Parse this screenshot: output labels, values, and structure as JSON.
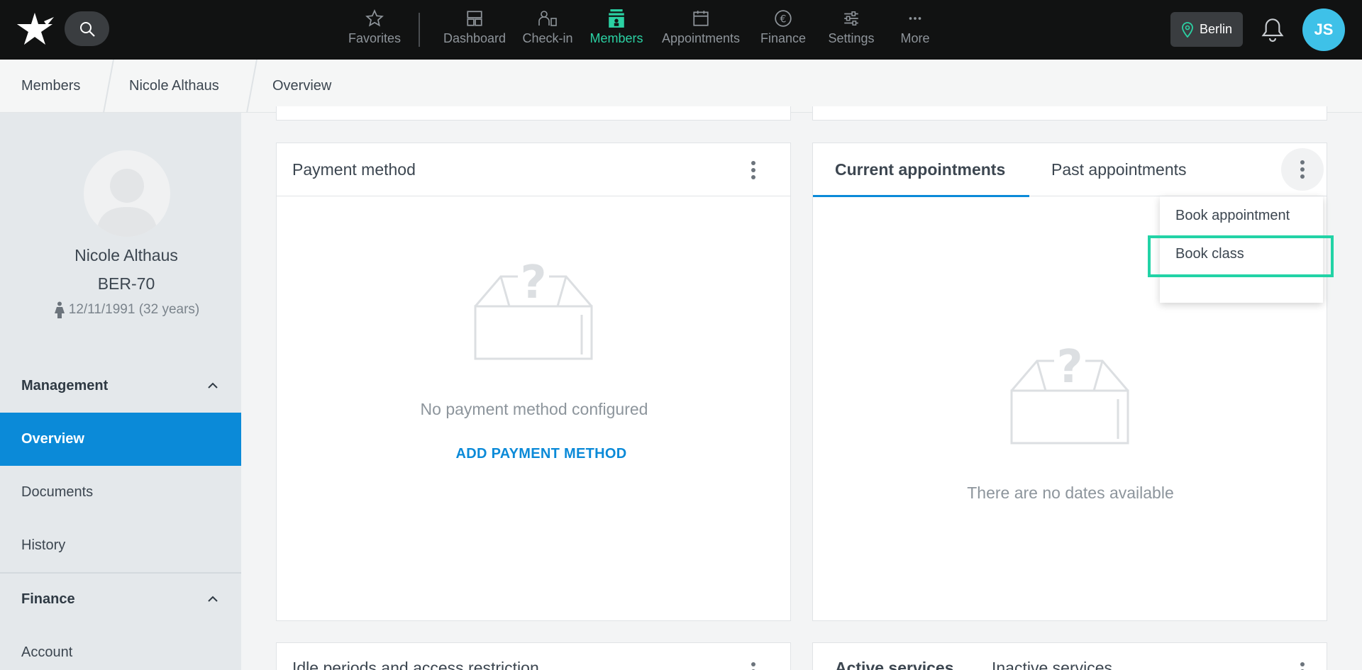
{
  "topbar": {
    "nav": [
      {
        "label": "Favorites",
        "icon": "star-icon"
      },
      {
        "label": "Dashboard",
        "icon": "dashboard-icon"
      },
      {
        "label": "Check-in",
        "icon": "check-in-icon"
      },
      {
        "label": "Members",
        "icon": "members-icon",
        "active": true
      },
      {
        "label": "Appointments",
        "icon": "calendar-icon"
      },
      {
        "label": "Finance",
        "icon": "euro-icon"
      },
      {
        "label": "Settings",
        "icon": "sliders-icon"
      },
      {
        "label": "More",
        "icon": "more-icon"
      }
    ],
    "location": "Berlin",
    "user_initials": "JS",
    "active_color": "#2bd1a3"
  },
  "breadcrumb": [
    "Members",
    "Nicole Althaus",
    "Overview"
  ],
  "profile": {
    "name": "Nicole Althaus",
    "member_id": "BER-70",
    "dob": "12/11/1991 (32 years)"
  },
  "sidebar": {
    "sections": [
      {
        "label": "Management",
        "items": [
          "Overview",
          "Documents",
          "History"
        ]
      },
      {
        "label": "Finance",
        "items": [
          "Account"
        ]
      }
    ],
    "active_item": "Overview",
    "accent": "#0b8ad8"
  },
  "payment_card": {
    "title": "Payment method",
    "empty_text": "No payment method configured",
    "action": "ADD PAYMENT METHOD"
  },
  "appointments_card": {
    "tabs": [
      "Current appointments",
      "Past appointments"
    ],
    "empty_text": "There are no dates available",
    "menu": [
      "Book appointment",
      "Book class"
    ]
  },
  "bottom_cards": {
    "left_title": "Idle periods and access restriction",
    "right_tabs": [
      "Active services",
      "Inactive services"
    ]
  }
}
